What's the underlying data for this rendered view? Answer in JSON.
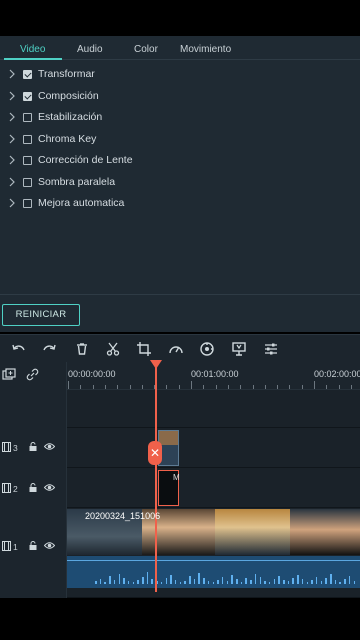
{
  "tabs": [
    {
      "label": "Video",
      "active": true
    },
    {
      "label": "Audio",
      "active": false
    },
    {
      "label": "Color",
      "active": false
    },
    {
      "label": "Movimiento",
      "active": false
    }
  ],
  "properties": [
    {
      "label": "Transformar",
      "checked": true
    },
    {
      "label": "Composición",
      "checked": true
    },
    {
      "label": "Estabilización",
      "checked": false
    },
    {
      "label": "Chroma Key",
      "checked": false
    },
    {
      "label": "Corrección de Lente",
      "checked": false
    },
    {
      "label": "Sombra paralela",
      "checked": false
    },
    {
      "label": "Mejora automatica",
      "checked": false
    }
  ],
  "reset_label": "REINICIAR",
  "toolbar_icons": [
    "undo-icon",
    "redo-icon",
    "delete-icon",
    "cut-icon",
    "crop-icon",
    "speed-icon",
    "color-icon",
    "audio-mixer-icon",
    "adjust-icon"
  ],
  "ruler": {
    "timecodes": [
      "00:00:00:00",
      "00:01:00:00",
      "00:02:00:00"
    ]
  },
  "tracks": [
    {
      "number": "3"
    },
    {
      "number": "2"
    },
    {
      "number": "1"
    }
  ],
  "clips": {
    "main_title": "20200324_151006",
    "black_clip_label": "M"
  },
  "colors": {
    "accent": "#4fd1c5",
    "playhead": "#f0614b",
    "panel_bg": "#1f2a33",
    "audio": "#1e4c73"
  }
}
